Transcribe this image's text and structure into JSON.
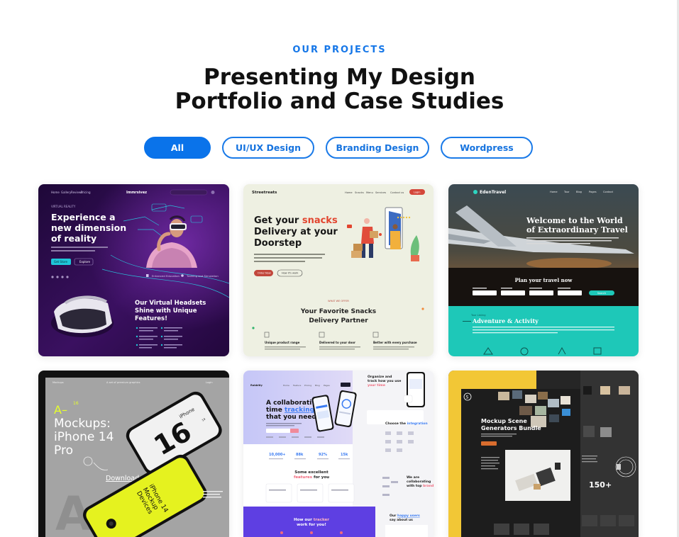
{
  "section": {
    "eyebrow": "OUR PROJECTS",
    "title_line1": "Presenting My Design",
    "title_line2": "Portfolio and Case Studies"
  },
  "filters": [
    {
      "label": "All",
      "active": true
    },
    {
      "label": "UI/UX Design",
      "active": false
    },
    {
      "label": "Branding Design",
      "active": false
    },
    {
      "label": "Wordpress",
      "active": false
    }
  ],
  "colors": {
    "accent": "#0a73ea",
    "vr_bg": "#2a0d4a",
    "snacks_bg": "#eef0e2",
    "travel_teal": "#1ec8b8",
    "mockup_yellow": "#f2c736",
    "dark_bg": "#2c2c2c"
  },
  "projects": {
    "vr": {
      "brand": "Immrsivez",
      "hero_1": "Experience a",
      "hero_2": "new dimension",
      "hero_3": "of reality",
      "eyebrow": "VIRTUAL REALITY",
      "cta_primary": "Get Store",
      "cta_secondary": "Explore",
      "section_1": "Our Virtual Headsets",
      "section_2": "Shine with Unique",
      "section_3": "Features!",
      "tag_1": "Enhanced Education",
      "tag_2": "Training and Simulation"
    },
    "snacks": {
      "brand": "Streetreats",
      "hero_1a": "Get your ",
      "hero_1b": "snacks",
      "hero_2": "Delivery at your",
      "hero_3": "Doorstep",
      "cta_primary": "Order Now",
      "cta_secondary": "How it's work",
      "eyebrow": "WHAT WE OFFER",
      "section_1": "Your Favorite Snacks",
      "section_2": "Delivery Partner",
      "feature_1": "Unique product range",
      "feature_2": "Delivered to your door",
      "feature_3": "Better with every purchase",
      "nav_cta": "Login"
    },
    "travel": {
      "brand": "EdenTravel",
      "hero_1": "Welcome to the World",
      "hero_2": "of Extraordinary Travel",
      "plan": "Plan your travel now",
      "search": "Search",
      "section": "Adventure & Activity",
      "section_eyebrow": "Tour Listing",
      "nav": [
        "Home",
        "Tour",
        "Blog",
        "Pages",
        "Contact"
      ]
    },
    "iphone": {
      "mark": "A–",
      "title_1": "Mockups:",
      "title_2": "iPhone 14",
      "title_3": "Pro",
      "link": "Download",
      "phone_big": "16",
      "phone_word": "iPhone",
      "phone_num": "14",
      "yellow_1": "iPhone 14",
      "yellow_2": "Mockup",
      "yellow_3": "Devices",
      "super": "16"
    },
    "app": {
      "brand": "Rabbitly",
      "hero_1": "A collaborative",
      "hero_2a": "time ",
      "hero_2b": "tracking",
      "hero_3": "that you need",
      "stats": [
        "10,000+",
        "88k",
        "92%",
        "15k"
      ],
      "features_1": "Some excellent",
      "features_2a": "features",
      "features_2b": " for you",
      "right_title_1": "Organize and",
      "right_title_2": "track how you use",
      "right_title_3": "your time",
      "right_choose": "Choose the ",
      "right_choose_b": "integration",
      "right_collab_1": "We are",
      "right_collab_2": "collaborating",
      "right_collab_3": "with top ",
      "right_collab_3b": "brands",
      "bottom_1a": "How our ",
      "bottom_1b": "tracker",
      "bottom_2": "work for you!",
      "reviews_1": "Our ",
      "reviews_1b": "happy users",
      "reviews_2": "say about us"
    },
    "mockup": {
      "title_1": "Mockup Scene",
      "title_2": "Generators Bundle",
      "big": "150+",
      "logo": "S"
    }
  }
}
